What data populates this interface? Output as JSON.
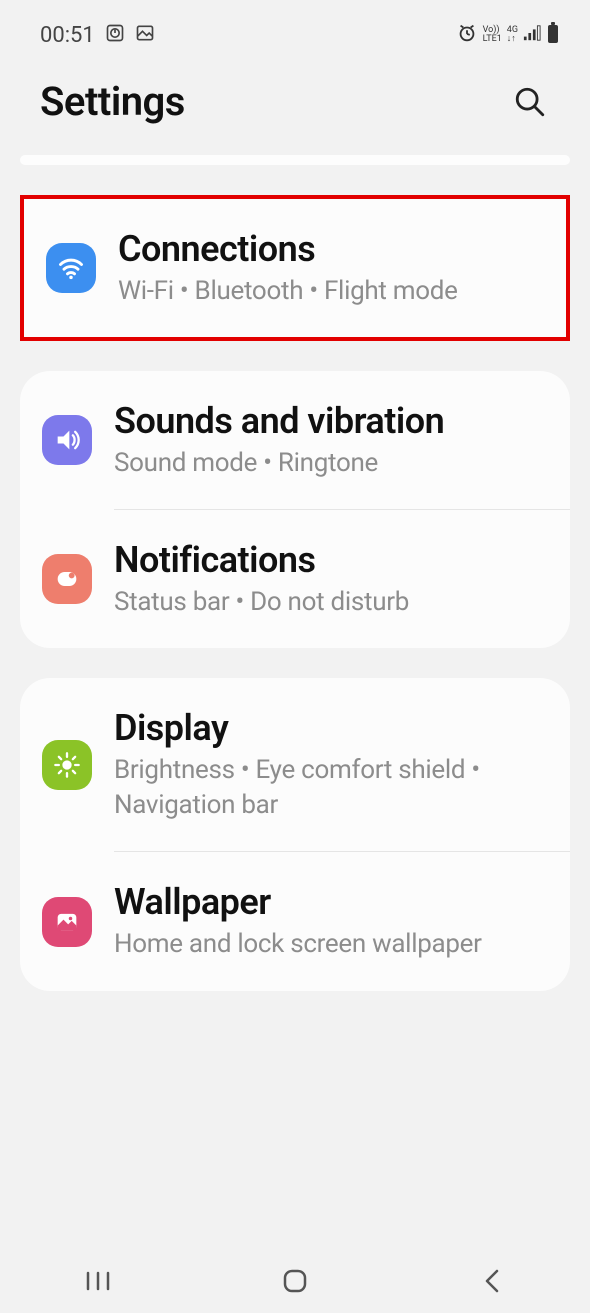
{
  "statusbar": {
    "time": "00:51",
    "indicators": [
      "clock-icon",
      "image-icon"
    ],
    "right_indicators": [
      "alarm",
      "VoLTE1",
      "4G",
      "signal",
      "battery"
    ]
  },
  "header": {
    "title": "Settings"
  },
  "groups": [
    {
      "highlighted": true,
      "items": [
        {
          "icon": "wifi",
          "color": "blue",
          "title": "Connections",
          "subtitle": "Wi-Fi  •  Bluetooth  •  Flight mode"
        }
      ]
    },
    {
      "items": [
        {
          "icon": "sound",
          "color": "purple",
          "title": "Sounds and vibration",
          "subtitle": "Sound mode  •  Ringtone"
        },
        {
          "icon": "notif",
          "color": "orange",
          "title": "Notifications",
          "subtitle": "Status bar  •  Do not disturb"
        }
      ]
    },
    {
      "items": [
        {
          "icon": "display",
          "color": "green",
          "title": "Display",
          "subtitle": "Brightness  •  Eye comfort shield  •  Navigation bar"
        },
        {
          "icon": "wallpaper",
          "color": "pink",
          "title": "Wallpaper",
          "subtitle": "Home and lock screen wallpaper"
        }
      ]
    }
  ]
}
